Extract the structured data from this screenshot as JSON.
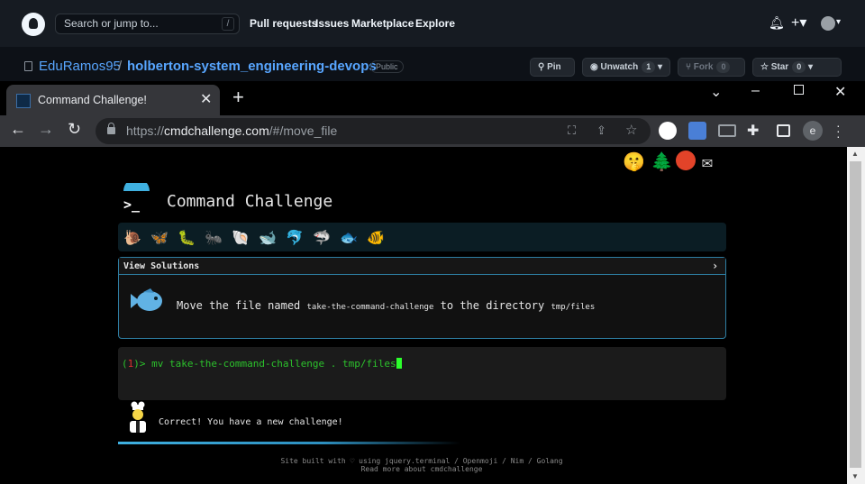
{
  "github": {
    "search_placeholder": "Search or jump to...",
    "search_shortcut": "/",
    "nav": [
      "Pull requests",
      "Issues",
      "Marketplace",
      "Explore"
    ],
    "owner": "EduRamos95",
    "separator": "/",
    "repo": "holberton-system_engineering-devops",
    "visibility": "Public",
    "buttons": {
      "pin": "Pin",
      "unwatch": "Unwatch",
      "unwatch_count": "1",
      "fork": "Fork",
      "fork_count": "0",
      "star": "Star",
      "star_count": "0"
    }
  },
  "browser": {
    "tab_title": "Command Challenge!",
    "url_scheme": "https://",
    "url_host": "cmdchallenge.com",
    "url_path": "/#/move_file",
    "profile_initial": "e"
  },
  "page": {
    "title": "Command Challenge",
    "levels": [
      "snail",
      "butterfly",
      "caterpillar",
      "ant",
      "shell",
      "whale",
      "dolphin",
      "shark",
      "fish",
      "tropical-fish"
    ],
    "solutions_label": "View Solutions",
    "task": {
      "prefix": "Move the file named",
      "file": "take-the-command-challenge",
      "middle": "to the directory",
      "dir": "tmp/files"
    },
    "terminal": {
      "number": "1",
      "command": "mv take-the-command-challenge . tmp/files"
    },
    "status": "Correct! You have a new challenge!",
    "progress": 0.5,
    "footer_line1": "Site built with ♡ using jquery.terminal / Openmoji / Nim / Golang",
    "footer_line2": "Read more about cmdchallenge"
  },
  "colors": {
    "accent": "#2e7ea3",
    "terminal_green": "#2cc22c",
    "github_link": "#58a6ff"
  }
}
